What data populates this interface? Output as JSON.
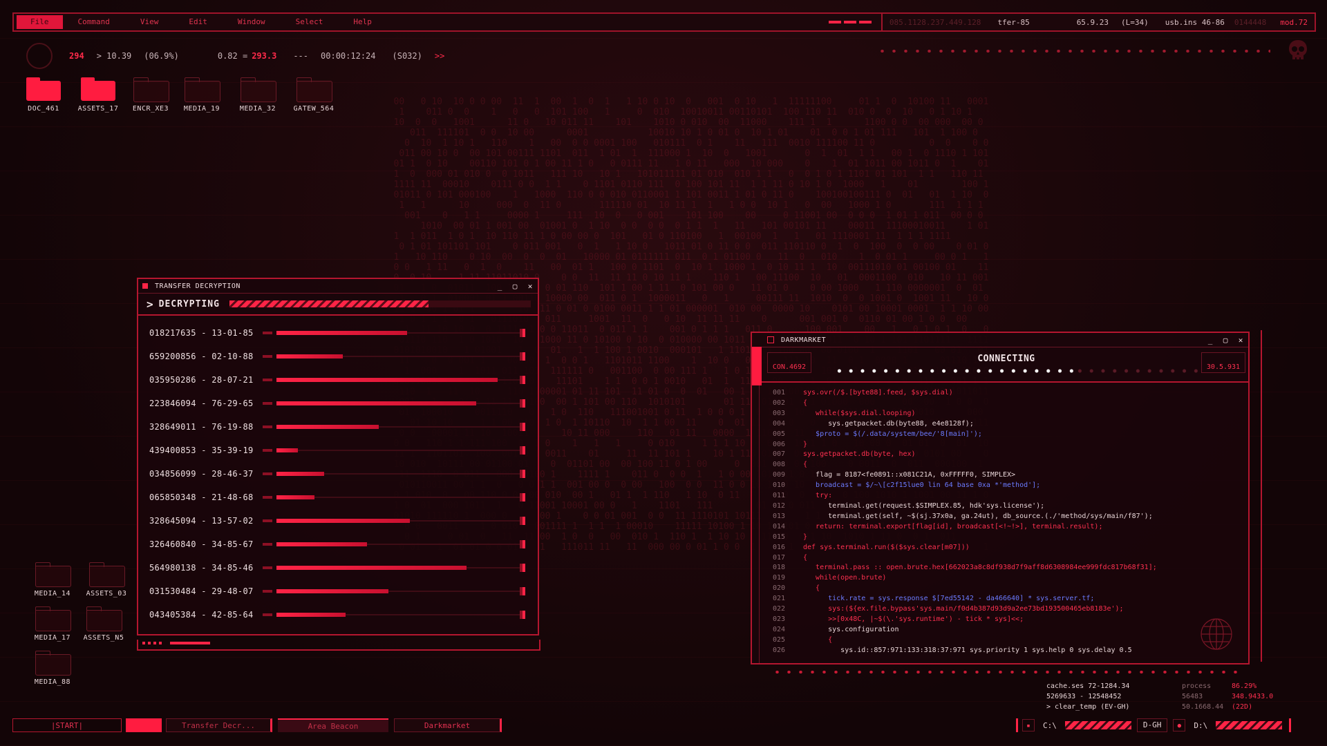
{
  "menu": {
    "items": [
      "File",
      "Command",
      "View",
      "Edit",
      "Window",
      "Select",
      "Help"
    ],
    "active_index": 0
  },
  "topstats": {
    "s1": "085.1128.237.449.128",
    "s2": "tfer-85",
    "s3": "65.9.23",
    "s4": "(L=34)",
    "s5": "usb.ins 46-86",
    "s6": "0144448",
    "s7": "mod.72"
  },
  "status": {
    "a": "294",
    "b": "10.39",
    "c": "(06.9%)",
    "d": "0.82 =",
    "e": "293.3",
    "f": "---",
    "g": "00:00:12:24",
    "h": "(S032)",
    "i": ">>"
  },
  "desktop_top": [
    "DOC_461",
    "ASSETS_17",
    "ENCR_XE3",
    "MEDIA_19",
    "MEDIA_32",
    "GATEW_564"
  ],
  "desktop_left": [
    "MEDIA_14",
    "ASSETS_03",
    "MEDIA_17",
    "ASSETS_N5",
    "MEDIA_88"
  ],
  "transfer": {
    "title": "TRANSFER DECRYPTION",
    "label": "DECRYPTING",
    "progress": 0.66,
    "rows": [
      {
        "text": "018217635 - 13-01-85",
        "progress": 0.55
      },
      {
        "text": "659200856 - 02-10-88",
        "progress": 0.28
      },
      {
        "text": "035950286 - 28-07-21",
        "progress": 0.93
      },
      {
        "text": "223846094 - 76-29-65",
        "progress": 0.84
      },
      {
        "text": "328649011 - 76-19-88",
        "progress": 0.43
      },
      {
        "text": "439400853 - 35-39-19",
        "progress": 0.09
      },
      {
        "text": "034856099 - 28-46-37",
        "progress": 0.2
      },
      {
        "text": "065850348 - 21-48-68",
        "progress": 0.16
      },
      {
        "text": "328645094 - 13-57-02",
        "progress": 0.56
      },
      {
        "text": "326460840 - 34-85-67",
        "progress": 0.38
      },
      {
        "text": "564980138 - 34-85-46",
        "progress": 0.8
      },
      {
        "text": "031530484 - 29-48-07",
        "progress": 0.47
      },
      {
        "text": "043405384 - 42-85-64",
        "progress": 0.29
      }
    ]
  },
  "darkmarket": {
    "title": "DARKMARKET",
    "connect_label": "CONNECTING",
    "left_box": "CON.4692",
    "right_box": "30.5.931",
    "progress": 0.66,
    "code": [
      {
        "n": "001",
        "t": "sys.ovr(/$.[byte88].feed, $sys.dial)",
        "c": "k-red"
      },
      {
        "n": "002",
        "t": "{",
        "c": "k-red"
      },
      {
        "n": "003",
        "t": "   while($sys.dial.looping)",
        "c": "k-red"
      },
      {
        "n": "004",
        "t": "      sys.getpacket.db(byte88, e4e8128f);",
        "c": "k-white"
      },
      {
        "n": "005",
        "t": "   $proto = $(/.data/system/bee/'8[main]');",
        "c": "k-blue"
      },
      {
        "n": "006",
        "t": "}",
        "c": "k-red"
      },
      {
        "n": "007",
        "t": "sys.getpacket.db(byte, hex)",
        "c": "k-red"
      },
      {
        "n": "008",
        "t": "{",
        "c": "k-red"
      },
      {
        "n": "009",
        "t": "   flag = 8187<fe0891::x081C21A, 0xFFFFF0, SIMPLEX>",
        "c": "k-white"
      },
      {
        "n": "010",
        "t": "   broadcast = $/~\\[c2f15lue0 lin 64 base 0xa *'method'];",
        "c": "k-blue"
      },
      {
        "n": "011",
        "t": "   try:",
        "c": "k-red"
      },
      {
        "n": "012",
        "t": "      terminal.get(request.$SIMPLEX.85, hdk'sys.license');",
        "c": "k-white"
      },
      {
        "n": "013",
        "t": "      terminal.get(self, ~$(sj.37x0a, ga.24ut), db_source.(./'method/sys/main/f87');",
        "c": "k-white"
      },
      {
        "n": "014",
        "t": "   return: terminal.export[flag[id], broadcast[<!~!>], terminal.result);",
        "c": "k-red"
      },
      {
        "n": "015",
        "t": "}",
        "c": "k-red"
      },
      {
        "n": "016",
        "t": "def sys.terminal.run($($sys.clear[m07]))",
        "c": "k-red"
      },
      {
        "n": "017",
        "t": "{",
        "c": "k-red"
      },
      {
        "n": "018",
        "t": "   terminal.pass :: open.brute.hex[662023a8c8df938d7f9aff8d6308984ee999fdc817b68f31];",
        "c": "k-red"
      },
      {
        "n": "019",
        "t": "   while(open.brute)",
        "c": "k-red"
      },
      {
        "n": "020",
        "t": "   {",
        "c": "k-red"
      },
      {
        "n": "021",
        "t": "      tick.rate = sys.response $[7ed55142 - da466640] * sys.server.tf;",
        "c": "k-blue"
      },
      {
        "n": "022",
        "t": "      sys:(${ex.file.bypass'sys.main/f0d4b387d93d9a2ee73bd193500465eb8183e');",
        "c": "k-red"
      },
      {
        "n": "023",
        "t": "      >>[0x48C, |~$(\\.'sys.runtime') - tick * sys]<<;",
        "c": "k-red"
      },
      {
        "n": "024",
        "t": "      sys.configuration",
        "c": "k-white"
      },
      {
        "n": "025",
        "t": "      {",
        "c": "k-red"
      },
      {
        "n": "026",
        "t": "         sys.id::857:971:133:318:37:971 sys.priority 1 sys.help 0 sys.delay 0.5",
        "c": "k-white"
      }
    ]
  },
  "bottom_stats": {
    "r1": {
      "a": "cache.ses   72-1284.34",
      "b": "process",
      "c": "86.29%"
    },
    "r2": {
      "a": "5269633 -   12548452",
      "b": "56483",
      "c": "348.9433.0"
    },
    "r3": {
      "a": "> clear_temp (EV-GH)",
      "b": "50.1668.44",
      "c": "(22D)"
    }
  },
  "taskbar": {
    "start": "|START|",
    "t1": "Transfer Decr...",
    "t2": "Area Beacon",
    "t3": "Darkmarket",
    "drive1": "C:\\",
    "tag": "D-GH",
    "drive2": "D:\\"
  },
  "colors": {
    "accent": "#ff2446",
    "background": "#130507",
    "border": "#b5162f"
  }
}
